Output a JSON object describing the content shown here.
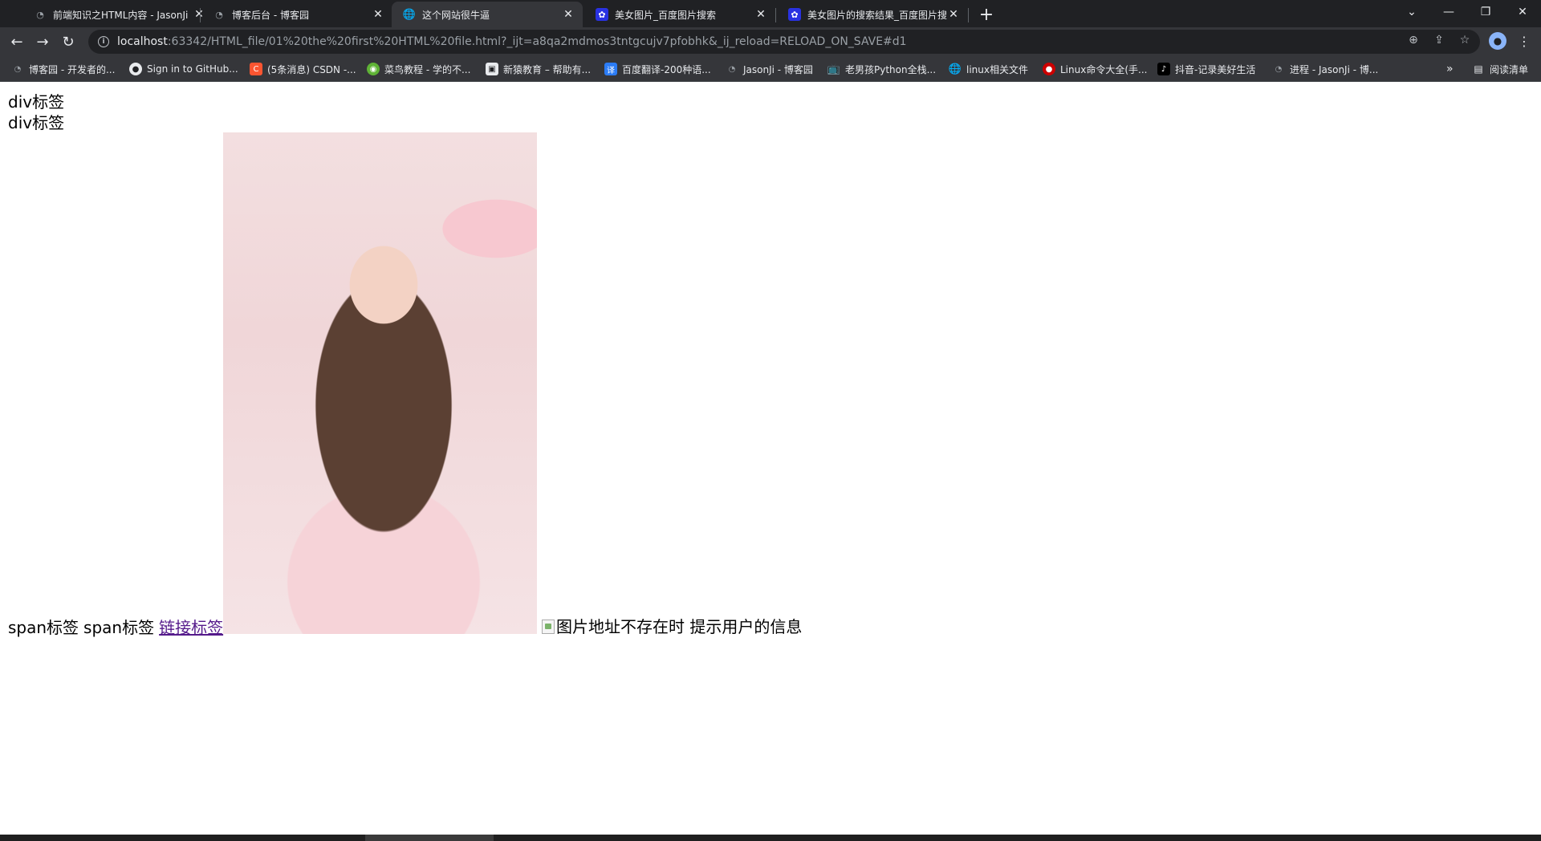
{
  "browser": {
    "tabs": [
      {
        "title": "前端知识之HTML内容 - JasonJi",
        "favicon": "cnblogs-icon",
        "active": false
      },
      {
        "title": "博客后台 - 博客园",
        "favicon": "cnblogs-icon",
        "active": false
      },
      {
        "title": "这个网站很牛逼",
        "favicon": "globe-icon",
        "active": true
      },
      {
        "title": "美女图片_百度图片搜索",
        "favicon": "baidu-icon",
        "active": false
      },
      {
        "title": "美女图片的搜索结果_百度图片搜",
        "favicon": "baidu-icon",
        "active": false
      }
    ],
    "address": {
      "host": "localhost",
      "rest": ":63342/HTML_file/01%20the%20first%20HTML%20file.html?_ijt=a8qa2mdmos3tntgcujv7pfobhk&_ij_reload=RELOAD_ON_SAVE#d1"
    },
    "bookmarks": [
      {
        "label": "博客园 - 开发者的...",
        "icon": "cnblogs-icon"
      },
      {
        "label": "Sign in to GitHub...",
        "icon": "github-icon"
      },
      {
        "label": "(5条消息) CSDN -...",
        "icon": "csdn-icon"
      },
      {
        "label": "菜鸟教程 - 学的不...",
        "icon": "runoob-icon"
      },
      {
        "label": "新猿教育 – 帮助有...",
        "icon": "xinyuan-icon"
      },
      {
        "label": "百度翻译-200种语...",
        "icon": "baidu-translate-icon"
      },
      {
        "label": "JasonJi - 博客园",
        "icon": "cnblogs-icon"
      },
      {
        "label": "老男孩Python全栈...",
        "icon": "bilibili-icon"
      },
      {
        "label": "linux相关文件",
        "icon": "globe-icon"
      },
      {
        "label": "Linux命令大全(手...",
        "icon": "redhat-icon"
      },
      {
        "label": "抖音-记录美好生活",
        "icon": "douyin-icon"
      },
      {
        "label": "进程 - JasonJi - 博...",
        "icon": "cnblogs-icon"
      }
    ],
    "bookmarks_more": "»",
    "reading_list": "阅读清单"
  },
  "page": {
    "div1": "div标签",
    "div2": "div标签",
    "span1": "span标签",
    "span2": "span标签",
    "link": "链接标签",
    "broken_alt": "图片地址不存在时 提示用户的信息"
  }
}
